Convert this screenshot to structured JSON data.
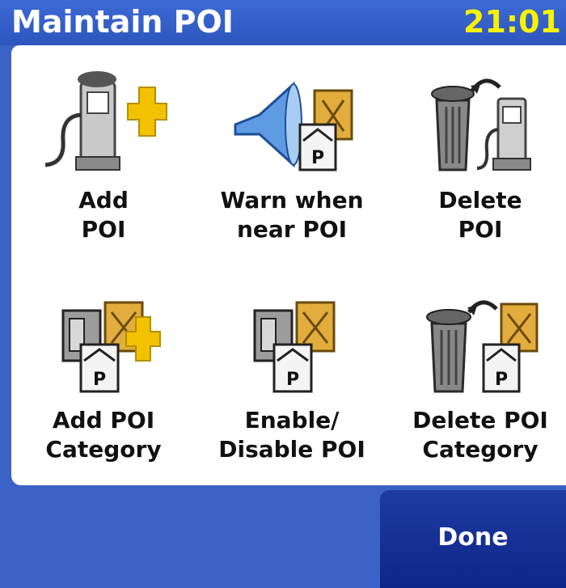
{
  "header": {
    "title": "Maintain POI",
    "clock": "21:01"
  },
  "items": [
    {
      "lines": [
        "Add",
        "POI"
      ],
      "icon": "fuel-pump-plus-icon"
    },
    {
      "lines": [
        "Warn when",
        "near POI"
      ],
      "icon": "speaker-poi-icon"
    },
    {
      "lines": [
        "Delete",
        "POI"
      ],
      "icon": "trash-fuel-pump-icon"
    },
    {
      "lines": [
        "Add POI",
        "Category"
      ],
      "icon": "poi-category-plus-icon"
    },
    {
      "lines": [
        "Enable/",
        "Disable POI"
      ],
      "icon": "poi-category-icon"
    },
    {
      "lines": [
        "Delete POI",
        "Category"
      ],
      "icon": "trash-poi-category-icon"
    }
  ],
  "footer": {
    "done_label": "Done"
  },
  "colors": {
    "header": "#2d55bd",
    "clock": "#f7f200",
    "panel": "#ffffff",
    "done_button": "#0d2687",
    "plus": "#f2c200"
  }
}
